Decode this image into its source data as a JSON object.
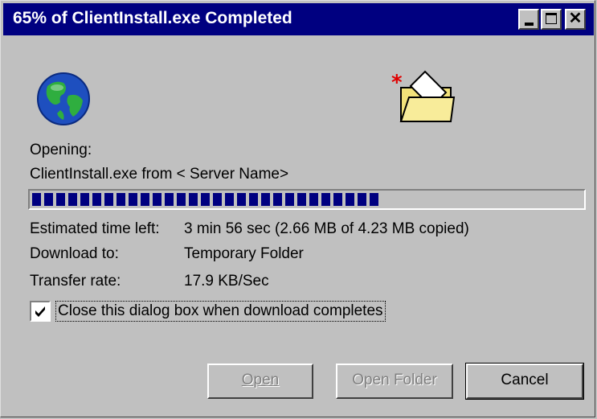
{
  "window": {
    "title": "65% of ClientInstall.exe Completed",
    "controls": {
      "minimize": "minimize-icon",
      "maximize": "maximize-icon",
      "close": "close-icon"
    }
  },
  "status": {
    "opening_label": "Opening:",
    "file_line": "ClientInstall.exe from < Server Name>"
  },
  "progress": {
    "percent": 65,
    "color": "#000080"
  },
  "details": {
    "time_left_label": "Estimated time left:",
    "time_left_value": "3 min 56 sec (2.66 MB of 4.23 MB copied)",
    "download_to_label": "Download to:",
    "download_to_value": "Temporary Folder",
    "transfer_rate_label": "Transfer rate:",
    "transfer_rate_value": "17.9 KB/Sec"
  },
  "checkbox": {
    "label": "Close this dialog box when download completes",
    "checked": true
  },
  "buttons": {
    "open": "Open",
    "open_folder": "Open Folder",
    "cancel": "Cancel"
  },
  "icons": {
    "globe": "globe-icon",
    "folder": "folder-icon"
  }
}
